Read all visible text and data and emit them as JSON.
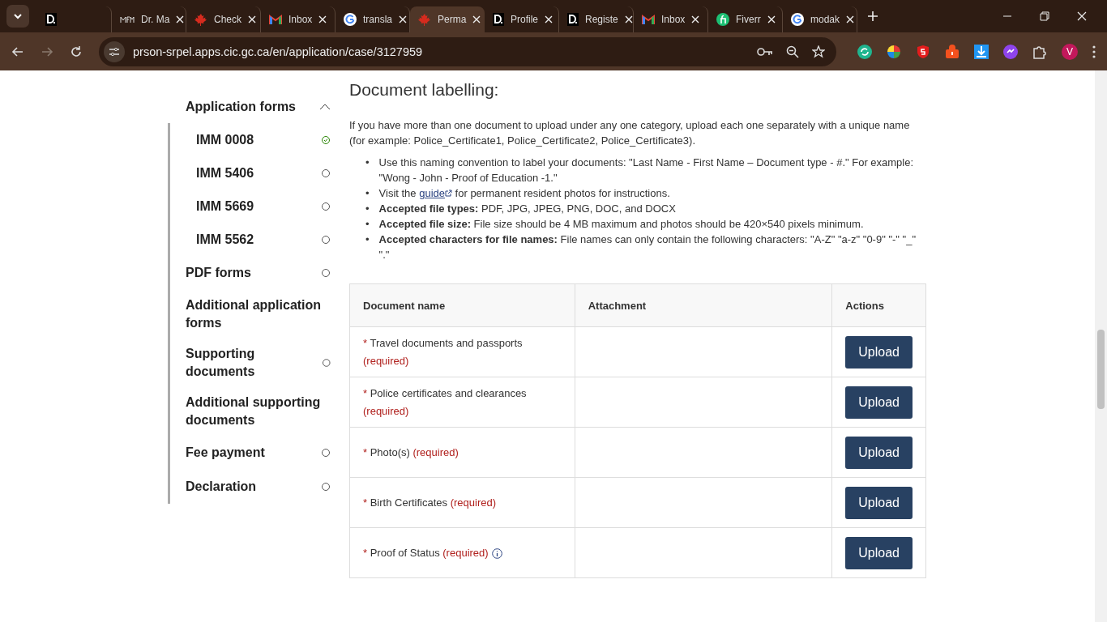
{
  "browser": {
    "tabs": [
      {
        "kind": "d",
        "selected": false
      },
      {
        "kind": "mfm",
        "title": "Dr. Ma",
        "selected": false
      },
      {
        "kind": "maple",
        "title": "Check",
        "selected": false
      },
      {
        "kind": "gmail",
        "title": "Inbox",
        "selected": false
      },
      {
        "kind": "google",
        "title": "transla",
        "selected": false
      },
      {
        "kind": "maple",
        "title": "Perma",
        "selected": true
      },
      {
        "kind": "d",
        "title": "Profile",
        "selected": false
      },
      {
        "kind": "d",
        "title": "Registe",
        "selected": false
      },
      {
        "kind": "gmail",
        "title": "Inbox",
        "selected": false
      },
      {
        "kind": "fiverr",
        "title": "Fiverr",
        "selected": false
      },
      {
        "kind": "google",
        "title": "modak",
        "selected": false
      }
    ],
    "url": "prson-srpel.apps.cic.gc.ca/en/application/case/3127959",
    "profile_initial": "V"
  },
  "sidebar": {
    "items": [
      {
        "label": "Application forms",
        "expanded": true,
        "children": [
          {
            "label": "IMM 0008",
            "complete": true
          },
          {
            "label": "IMM 5406",
            "complete": false
          },
          {
            "label": "IMM 5669",
            "complete": false
          },
          {
            "label": "IMM 5562",
            "complete": false
          }
        ]
      },
      {
        "label": "PDF forms",
        "complete": false
      },
      {
        "label": "Additional application forms"
      },
      {
        "label": "Supporting documents",
        "complete": false
      },
      {
        "label": "Additional supporting documents"
      },
      {
        "label": "Fee payment",
        "complete": false
      },
      {
        "label": "Declaration",
        "complete": false
      }
    ]
  },
  "content": {
    "heading": "Document labelling:",
    "intro": "If you have more than one document to upload under any one category, upload each one separately with a unique name (for example: Police_Certificate1, Police_Certificate2, Police_Certificate3).",
    "bullets": [
      {
        "marker": "•",
        "text": "Use this naming convention to label your documents: \"Last Name - First Name – Document type - #.\" For example: \"Wong - John - Proof of Education -1.\""
      },
      {
        "marker": "•",
        "before": "Visit the",
        "link": "guide",
        "after": "for permanent resident photos for instructions."
      },
      {
        "marker": "•",
        "text": "**Accepted file types:** PDF, JPG, JPEG, PNG, DOC, and DOCX"
      },
      {
        "marker": "•",
        "text": "**Accepted file size:** File size should be 4 MB maximum and photos should be 420×540 pixels minimum."
      },
      {
        "marker": "•",
        "text": "**Accepted characters for file names:** File names can only contain the following characters: \"A-Z\" \"a-z\" \"0-9\" \"-\" \"_\" \".\""
      }
    ],
    "table": {
      "columns": [
        "Document name",
        "Attachment",
        "Actions"
      ],
      "rows": [
        {
          "mark": "*",
          "name": "Travel documents and passports",
          "note": "(required)",
          "action": "Upload",
          "info": false
        },
        {
          "mark": "*",
          "name": "Police certificates and clearances",
          "note": "(required)",
          "action": "Upload",
          "info": false
        },
        {
          "mark": "*",
          "name": "Photo(s)",
          "note": "(required)",
          "action": "Upload",
          "info": false
        },
        {
          "mark": "*",
          "name": "Birth Certificates",
          "note": "(required)",
          "action": "Upload",
          "info": false
        },
        {
          "mark": "*",
          "name": "Proof of Status",
          "note": "(required)",
          "action": "Upload",
          "info": true
        }
      ]
    }
  }
}
